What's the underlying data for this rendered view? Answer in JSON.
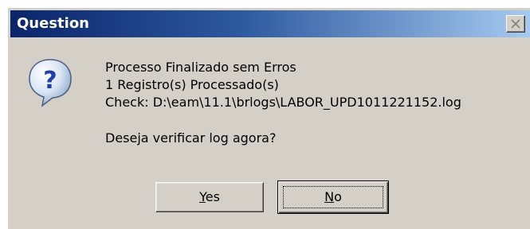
{
  "dialog": {
    "title": "Question",
    "close_icon": "close-icon",
    "icon": "question-icon",
    "message": {
      "line1": "Processo Finalizado sem Erros",
      "line2": "1 Registro(s) Processado(s)",
      "line3": "Check:  D:\\eam\\11.1\\brlogs\\LABOR_UPD1011221152.log",
      "question": "Deseja verificar log agora?"
    },
    "buttons": {
      "yes": {
        "accel": "Y",
        "rest": "es"
      },
      "no": {
        "accel": "N",
        "rest": "o"
      }
    },
    "colors": {
      "title_start": "#0a246a",
      "title_end": "#a6caf0",
      "face": "#d4d0c8"
    }
  }
}
